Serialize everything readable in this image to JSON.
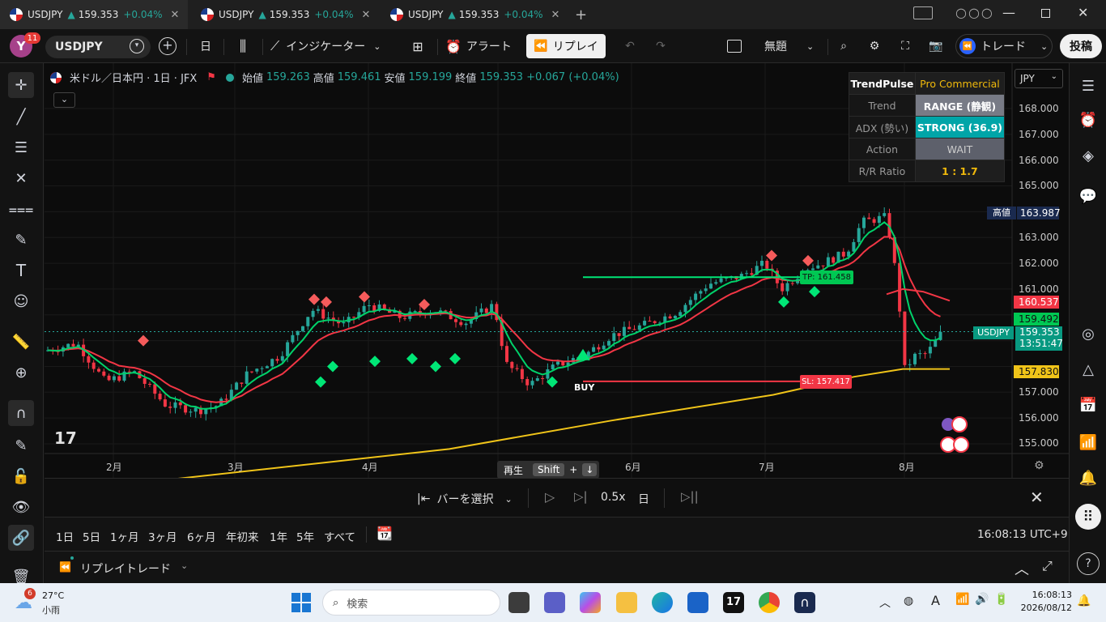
{
  "tabs": [
    {
      "symbol": "USDJPY",
      "price": "159.353",
      "change": "+0.04%"
    },
    {
      "symbol": "USDJPY",
      "price": "159.353",
      "change": "+0.04%"
    },
    {
      "symbol": "USDJPY",
      "price": "159.353",
      "change": "+0.04%"
    }
  ],
  "toolbar": {
    "avatar": "Y",
    "notif": "11",
    "symbol": "USDJPY",
    "interval": "日",
    "indicators": "インジケーター",
    "alert": "アラート",
    "replay": "リプレイ",
    "layout_name": "無題",
    "trade": "トレード",
    "publish": "投稿"
  },
  "legend": {
    "title": "米ドル／日本円 · 1日 · JFX",
    "open_label": "始値",
    "open": "159.263",
    "high_label": "高値",
    "high": "159.461",
    "low_label": "安値",
    "low": "159.199",
    "close_label": "終値",
    "close": "159.353",
    "change": "+0.067 (+0.04%)"
  },
  "trendpulse": {
    "name": "TrendPulse",
    "tier": "Pro Commercial",
    "rows": [
      {
        "label": "Trend",
        "value": "RANGE (静観)"
      },
      {
        "label": "ADX (勢い)",
        "value": "STRONG (36.9)"
      },
      {
        "label": "Action",
        "value": "WAIT"
      },
      {
        "label": "R/R Ratio",
        "value": "1 : 1.7"
      }
    ]
  },
  "currency": "JPY",
  "price_axis": [
    "168.000",
    "167.000",
    "166.000",
    "165.000",
    "163.000",
    "162.000",
    "161.000",
    "157.000",
    "156.000",
    "155.000"
  ],
  "price_labels": {
    "high_label": "高値",
    "high": "163.987",
    "tp_level": "160.537",
    "level2": "159.492",
    "symbol": "USDJPY",
    "last": "159.353",
    "countdown": "13:51:47",
    "sl_level": "157.830"
  },
  "tp_text": "TP: 161.458",
  "sl_text": "SL: 157.417",
  "buy": "BUY",
  "months": [
    "2月",
    "3月",
    "4月",
    "6月",
    "7月",
    "8月"
  ],
  "replay": {
    "play_tip": "再生",
    "shift": "Shift",
    "plus": "+",
    "down": "↓",
    "select_bar": "バーを選択",
    "speed": "0.5x",
    "interval": "日"
  },
  "ranges": [
    "1日",
    "5日",
    "1ヶ月",
    "3ヶ月",
    "6ヶ月",
    "年初来",
    "1年",
    "5年",
    "すべて"
  ],
  "clock": "16:08:13 UTC+9",
  "bottom_panel": "リプレイトレード",
  "taskbar": {
    "weather_badge": "6",
    "temp": "27°C",
    "cond": "小雨",
    "search": "検索",
    "time": "16:08:13",
    "date": "2026/08/12"
  }
}
